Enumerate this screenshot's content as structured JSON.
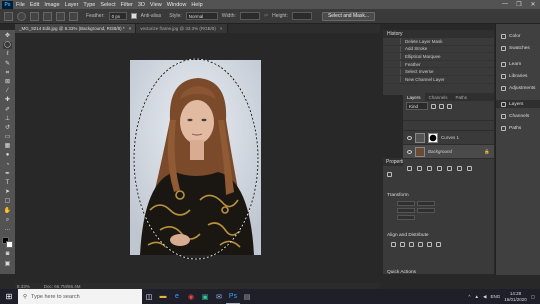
{
  "app": {
    "name": "Ps"
  },
  "menu": [
    "File",
    "Edit",
    "Image",
    "Layer",
    "Type",
    "Select",
    "Filter",
    "3D",
    "View",
    "Window",
    "Help"
  ],
  "window_controls": [
    "—",
    "❐",
    "✕"
  ],
  "options": {
    "feather_label": "Feather:",
    "feather_value": "0 px",
    "antialias_label": "Anti-alias",
    "style_label": "Style:",
    "style_value": "Normal",
    "width_label": "Width:",
    "height_label": "Height:",
    "select_mask_button": "Select and Mask..."
  },
  "doc_tabs": [
    {
      "label": "_MG_9214 Edit.jpg @ 8.33% (Background, RGB/8) *",
      "close": "×"
    },
    {
      "label": "vectorize frame.jpg @ 33.3% (RGB/8)",
      "close": "×"
    }
  ],
  "status": {
    "zoom": "8.33%",
    "doc": "Doc: 66.7M/66.4M"
  },
  "history": {
    "title": "History",
    "items": [
      "Delete Layer Mask",
      "Add Stroke",
      "Elliptical Marquee",
      "Feather",
      "Select Inverse",
      "New Channel Layer"
    ]
  },
  "layers": {
    "tabs": [
      "Layers",
      "Channels",
      "Paths"
    ],
    "kind_label": "Kind",
    "rows": [
      {
        "name": "Curves 1"
      },
      {
        "name": "Background"
      }
    ]
  },
  "properties": {
    "title": "Properties",
    "transform": "Transform",
    "align": "Align and Distribute",
    "quick_actions": "Quick Actions"
  },
  "dock": [
    "Color",
    "Swatches",
    "Learn",
    "Libraries",
    "Adjustments",
    "Layers",
    "Channels",
    "Paths"
  ],
  "taskbar": {
    "search_placeholder": "Type here to search",
    "time": "14:28",
    "date": "16/01/2020",
    "tray_lang": "ENG"
  },
  "colors": {
    "ps_blue": "#31a8ff",
    "ps_dark": "#001e36",
    "panel": "#3a3a3a",
    "canvas_bg": "#282828"
  }
}
